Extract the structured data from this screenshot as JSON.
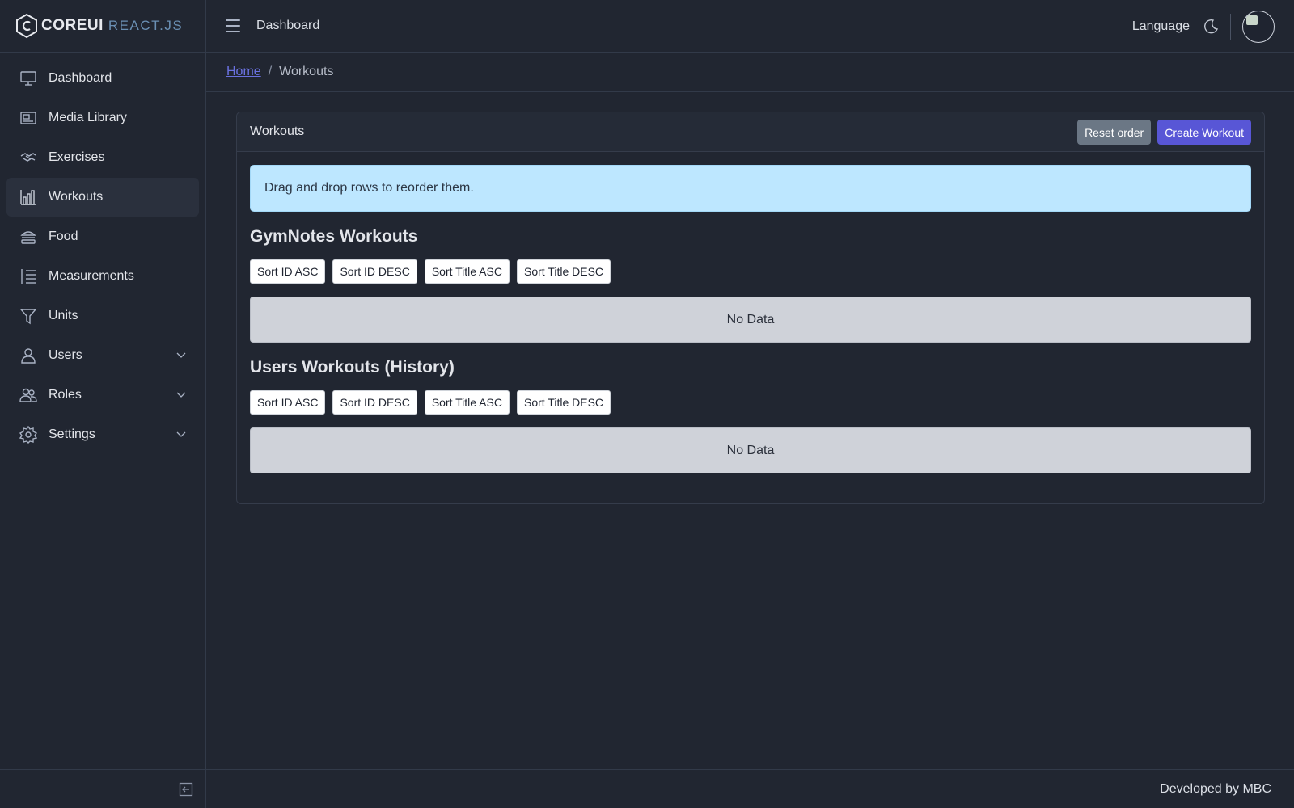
{
  "brand": {
    "core": "COREUI",
    "react": "REACT.JS"
  },
  "sidebar": {
    "items": [
      {
        "label": "Dashboard",
        "icon": "monitor-icon"
      },
      {
        "label": "Media Library",
        "icon": "image-icon"
      },
      {
        "label": "Exercises",
        "icon": "handshake-icon"
      },
      {
        "label": "Workouts",
        "icon": "bar-chart-icon",
        "active": true
      },
      {
        "label": "Food",
        "icon": "burger-icon"
      },
      {
        "label": "Measurements",
        "icon": "list-numbered-icon"
      },
      {
        "label": "Units",
        "icon": "filter-icon"
      },
      {
        "label": "Users",
        "icon": "user-icon",
        "has_children": true
      },
      {
        "label": "Roles",
        "icon": "people-icon",
        "has_children": true
      },
      {
        "label": "Settings",
        "icon": "gear-icon",
        "has_children": true
      }
    ]
  },
  "header": {
    "nav_link": "Dashboard",
    "language": "Language"
  },
  "breadcrumb": {
    "home": "Home",
    "separator": "/",
    "current": "Workouts"
  },
  "card": {
    "title": "Workouts",
    "reset_label": "Reset order",
    "create_label": "Create Workout",
    "alert": "Drag and drop rows to reorder them.",
    "sections": [
      {
        "title": "GymNotes Workouts",
        "sort_buttons": [
          "Sort ID ASC",
          "Sort ID DESC",
          "Sort Title ASC",
          "Sort Title DESC"
        ],
        "empty": "No Data"
      },
      {
        "title": "Users Workouts (History)",
        "sort_buttons": [
          "Sort ID ASC",
          "Sort ID DESC",
          "Sort Title ASC",
          "Sort Title DESC"
        ],
        "empty": "No Data"
      }
    ]
  },
  "footer": {
    "text": "Developed by MBC"
  },
  "colors": {
    "background": "#212631",
    "primary": "#5856d6",
    "secondary": "#6b7785",
    "alert": "#bde7ff"
  }
}
